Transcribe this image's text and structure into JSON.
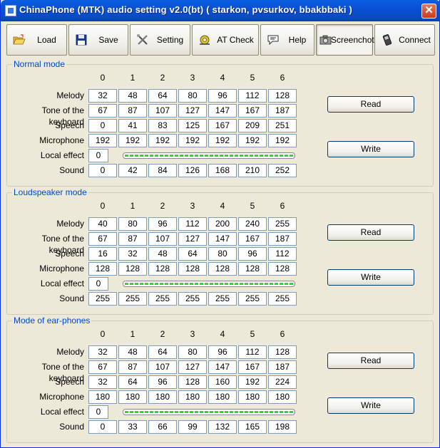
{
  "window": {
    "title": "ChinaPhone (MTK) audio setting v2.0(bt) ( starkon, pvsurkov, bbakbbaki )",
    "close_glyph": "✕"
  },
  "toolbar": [
    {
      "id": "load",
      "label": "Load",
      "icon": "folder-open-icon"
    },
    {
      "id": "save",
      "label": "Save",
      "icon": "floppy-disk-icon"
    },
    {
      "id": "setting",
      "label": "Setting",
      "icon": "tools-icon"
    },
    {
      "id": "at-check",
      "label": "AT Check",
      "icon": "gear-check-icon"
    },
    {
      "id": "help",
      "label": "Help",
      "icon": "speech-bubble-icon"
    },
    {
      "id": "screenshot",
      "label": "Screenchot",
      "icon": "camera-icon"
    },
    {
      "id": "connect",
      "label": "Connect",
      "icon": "phone-icon"
    }
  ],
  "columns": [
    "0",
    "1",
    "2",
    "3",
    "4",
    "5",
    "6"
  ],
  "row_labels": {
    "melody": "Melody",
    "keyboard": "Tone of the keyboard",
    "speech": "Speech",
    "microphone": "Microphone",
    "local_effect": "Local effect",
    "sound": "Sound"
  },
  "buttons": {
    "read": "Read",
    "write": "Write"
  },
  "modes": [
    {
      "title": "Normal mode",
      "melody": [
        "32",
        "48",
        "64",
        "80",
        "96",
        "112",
        "128"
      ],
      "keyboard": [
        "67",
        "87",
        "107",
        "127",
        "147",
        "167",
        "187"
      ],
      "speech": [
        "0",
        "41",
        "83",
        "125",
        "167",
        "209",
        "251"
      ],
      "microphone": [
        "192",
        "192",
        "192",
        "192",
        "192",
        "192",
        "192"
      ],
      "local_effect": "0",
      "sound": [
        "0",
        "42",
        "84",
        "126",
        "168",
        "210",
        "252"
      ]
    },
    {
      "title": "Loudspeaker mode",
      "melody": [
        "40",
        "80",
        "96",
        "112",
        "200",
        "240",
        "255"
      ],
      "keyboard": [
        "67",
        "87",
        "107",
        "127",
        "147",
        "167",
        "187"
      ],
      "speech": [
        "16",
        "32",
        "48",
        "64",
        "80",
        "96",
        "112"
      ],
      "microphone": [
        "128",
        "128",
        "128",
        "128",
        "128",
        "128",
        "128"
      ],
      "local_effect": "0",
      "sound": [
        "255",
        "255",
        "255",
        "255",
        "255",
        "255",
        "255"
      ]
    },
    {
      "title": "Mode of ear-phones",
      "melody": [
        "32",
        "48",
        "64",
        "80",
        "96",
        "112",
        "128"
      ],
      "keyboard": [
        "67",
        "87",
        "107",
        "127",
        "147",
        "167",
        "187"
      ],
      "speech": [
        "32",
        "64",
        "96",
        "128",
        "160",
        "192",
        "224"
      ],
      "microphone": [
        "180",
        "180",
        "180",
        "180",
        "180",
        "180",
        "180"
      ],
      "local_effect": "0",
      "sound": [
        "0",
        "33",
        "66",
        "99",
        "132",
        "165",
        "198"
      ]
    }
  ]
}
